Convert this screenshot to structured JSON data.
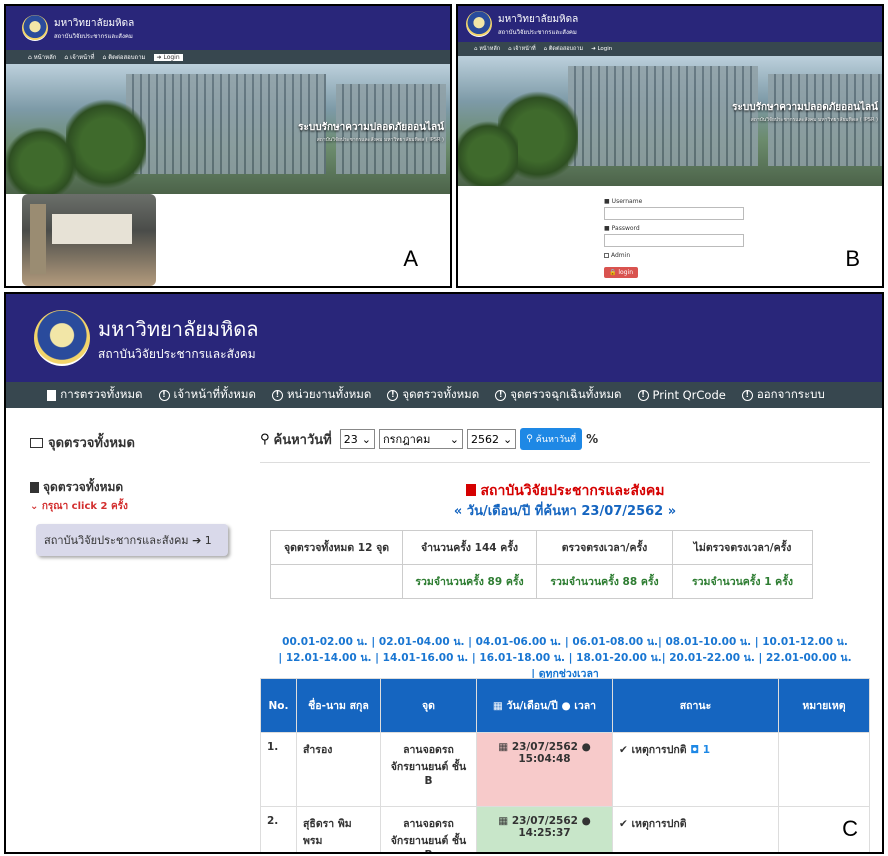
{
  "panel_a": {
    "univ_name": "มหาวิทยาลัยมหิดล",
    "inst_name": "สถาบันวิจัยประชากรและสังคม",
    "nav": [
      "หน้าหลัก",
      "เจ้าหน้าที่",
      "ติดต่อสอบถาม",
      "Login"
    ],
    "hero_title": "ระบบรักษาความปลอดภัยออนไลน์",
    "hero_sub": "สถาบันวิจัยประชากรและสังคม มหาวิทยาลัยมหิดล ( IPSR )",
    "label": "A"
  },
  "panel_b": {
    "univ_name": "มหาวิทยาลัยมหิดล",
    "inst_name": "สถาบันวิจัยประชากรและสังคม",
    "nav": [
      "หน้าหลัก",
      "เจ้าหน้าที่",
      "ติดต่อสอบถาม",
      "Login"
    ],
    "hero_title": "ระบบรักษาความปลอดภัยออนไลน์",
    "hero_sub": "สถาบันวิจัยประชากรและสังคม มหาวิทยาลัยมหิดล ( IPSR )",
    "username_label": "Username",
    "password_label": "Password",
    "admin_label": "Admin",
    "login_button": "login",
    "label": "B"
  },
  "panel_c": {
    "univ_name": "มหาวิทยาลัยมหิดล",
    "inst_name": "สถาบันวิจัยประชากรและสังคม",
    "nav": {
      "all_checks": "การตรวจทั้งหมด",
      "all_staff": "เจ้าหน้าที่ทั้งหมด",
      "all_units": "หน่วยงานทั้งหมด",
      "all_points": "จุดตรวจทั้งหมด",
      "emergency_points": "จุดตรวจฉุกเฉินทั้งหมด",
      "print_qr": "Print QrCode",
      "logout": "ออกจากระบบ"
    },
    "page_title": "จุดตรวจทั้งหมด",
    "search_label": "ค้นหาวันที่",
    "day": "23",
    "month": "กรกฎาคม",
    "year": "2562",
    "search_button": "ค้นหาวันที่",
    "percent": "%",
    "sidebar_title": "จุดตรวจทั้งหมด",
    "sidebar_hint": "กรุณา click 2 ครั้ง",
    "sidebar_item": "สถาบันวิจัยประชากรและสังคม",
    "sidebar_item_count": "1",
    "org_title": "สถาบันวิจัยประชากรและสังคม",
    "date_line": "« วัน/เดือน/ปี ที่ค้นหา 23/07/2562 »",
    "summary": {
      "h1": "จุดตรวจทั้งหมด 12 จุด",
      "h2": "จำนวนครั้ง 144 ครั้ง",
      "h3": "ตรวจตรงเวลา/ครั้ง",
      "h4": "ไม่ตรวจตรงเวลา/ครั้ง",
      "v2": "รวมจำนวนครั้ง 89 ครั้ง",
      "v3": "รวมจำนวนครั้ง 88 ครั้ง",
      "v4": "รวมจำนวนครั้ง 1 ครั้ง"
    },
    "time_links_1": "00.01-02.00 น. | 02.01-04.00 น. | 04.01-06.00 น. | 06.01-08.00 น.| 08.01-10.00 น. | 10.01-12.00 น.",
    "time_links_2": "| 12.01-14.00 น. | 14.01-16.00 น. | 16.01-18.00 น. | 18.01-20.00 น.| 20.01-22.00 น. | 22.01-00.00 น.",
    "time_links_3": "| ดูทุกช่วงเวลา",
    "table": {
      "col_no": "No.",
      "col_name": "ชื่อ-นาม สกุล",
      "col_point": "จุด",
      "col_datetime": "วัน/เดือน/ปี",
      "col_time": "เวลา",
      "col_status": "สถานะ",
      "col_note": "หมายเหตุ",
      "rows": [
        {
          "no": "1.",
          "name": "สำรอง",
          "point": "ลานจอดรถ จักรยานยนต์ ชั้น B",
          "date": "23/07/2562",
          "time": "15:04:48",
          "status": "เหตุการปกติ",
          "photo_count": "1"
        },
        {
          "no": "2.",
          "name": "สุธิดรา พิม พรม",
          "point": "ลานจอดรถ จักรยานยนต์ ชั้น B",
          "date": "23/07/2562",
          "time": "14:25:37",
          "status": "เหตุการปกติ",
          "photo_count": ""
        }
      ]
    },
    "label": "C"
  }
}
